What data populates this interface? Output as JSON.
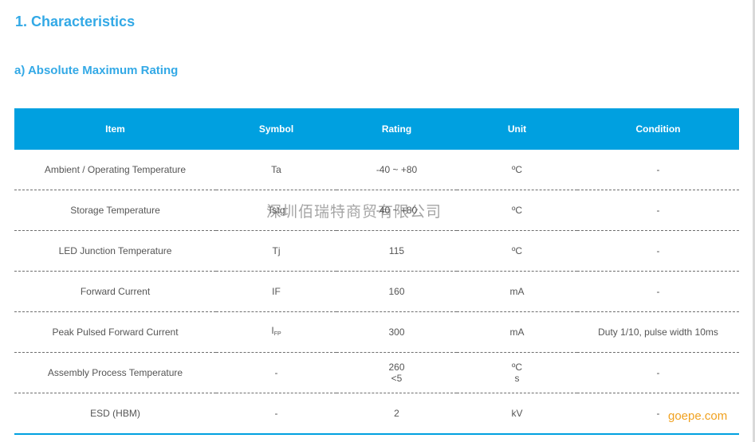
{
  "headings": {
    "section": "1.  Characteristics",
    "subsection": "a)  Absolute Maximum Rating"
  },
  "table": {
    "headers": [
      "Item",
      "Symbol",
      "Rating",
      "Unit",
      "Condition"
    ],
    "rows": [
      {
        "item": "Ambient / Operating Temperature",
        "symbol": "Ta",
        "rating": "-40 ~ +80",
        "unit": "ºC",
        "condition": "-"
      },
      {
        "item": "Storage Temperature",
        "symbol": "Tstg",
        "rating": "-40 ~ +80",
        "unit": "ºC",
        "condition": "-"
      },
      {
        "item": "LED Junction Temperature",
        "symbol": "Tj",
        "rating": "115",
        "unit": "ºC",
        "condition": "-"
      },
      {
        "item": "Forward Current",
        "symbol": "IF",
        "rating": "160",
        "unit": "mA",
        "condition": "-"
      },
      {
        "item": "Peak Pulsed Forward Current",
        "symbol_main": "I",
        "symbol_sub": "FP",
        "rating": "300",
        "unit": "mA",
        "condition": "Duty 1/10, pulse width 10ms"
      },
      {
        "item": "Assembly Process Temperature",
        "symbol": "-",
        "rating_line1": "260",
        "rating_line2": "<5",
        "unit_line1": "ºC",
        "unit_line2": "s",
        "condition": "-"
      },
      {
        "item": "ESD (HBM)",
        "symbol": "-",
        "rating": "2",
        "unit": "kV",
        "condition": "-"
      }
    ]
  },
  "watermark": "深圳佰瑞特商贸有限公司",
  "site_mark": "goepe.com",
  "colors": {
    "accent": "#00a0e0",
    "heading": "#33a9e6",
    "site_mark": "#f0a11f"
  }
}
